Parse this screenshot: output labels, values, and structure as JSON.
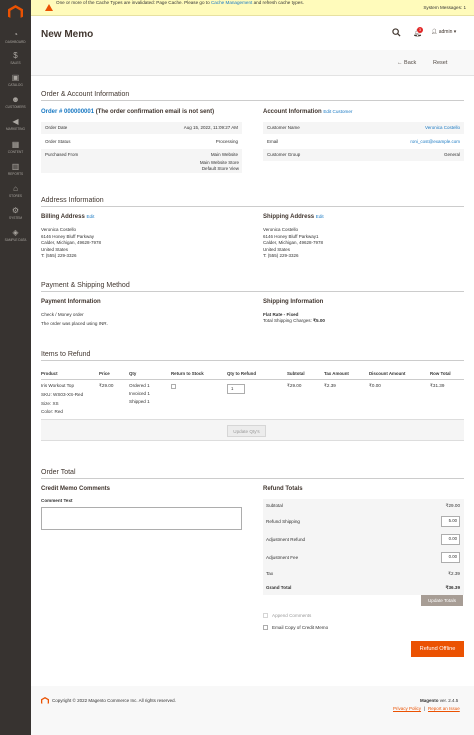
{
  "sidebar": {
    "items": [
      {
        "label": "DASHBOARD",
        "icon": "speedometer-icon",
        "glyph": "◔"
      },
      {
        "label": "SALES",
        "icon": "dollar-icon",
        "glyph": "$"
      },
      {
        "label": "CATALOG",
        "icon": "box-icon",
        "glyph": "▣"
      },
      {
        "label": "CUSTOMERS",
        "icon": "person-icon",
        "glyph": "☻"
      },
      {
        "label": "MARKETING",
        "icon": "megaphone-icon",
        "glyph": "◀"
      },
      {
        "label": "CONTENT",
        "icon": "layout-icon",
        "glyph": "▦"
      },
      {
        "label": "REPORTS",
        "icon": "bar-chart-icon",
        "glyph": "▥"
      },
      {
        "label": "STORES",
        "icon": "storefront-icon",
        "glyph": "⌂"
      },
      {
        "label": "SYSTEM",
        "icon": "gear-icon",
        "glyph": "⚙"
      },
      {
        "label": "SAMPLE DATA",
        "icon": "puzzle-icon",
        "glyph": "◈"
      }
    ]
  },
  "message": {
    "before": "One or more of the Cache Types are invalidated: Page Cache. Please go to",
    "link": "Cache Management",
    "after": "and refresh cache types.",
    "system": "System Messages: 1"
  },
  "header": {
    "title": "New Memo",
    "badge": "3",
    "user": "admin"
  },
  "actions": {
    "back": "← Back",
    "reset": "Reset"
  },
  "order_account": {
    "section": "Order & Account Information",
    "order_link": "Order # 000000001",
    "order_note": "(The order confirmation email is not sent)",
    "rows": [
      {
        "label": "Order Date",
        "value": "Aug 15, 2022, 11:09:27 AM"
      },
      {
        "label": "Order Status",
        "value": "Processing"
      },
      {
        "label": "Purchased From",
        "value": "Main Website"
      }
    ],
    "store1": "Main Website Store",
    "store2": "Default Store View",
    "account_title": "Account Information",
    "edit_customer": "Edit Customer",
    "acc_rows": [
      {
        "label": "Customer Name",
        "value": "Veronica Costello"
      },
      {
        "label": "Email",
        "value": "roni_cost@example.com"
      },
      {
        "label": "Customer Group",
        "value": "General"
      }
    ]
  },
  "address": {
    "section": "Address Information",
    "billing_title": "Billing Address",
    "shipping_title": "Shipping Address",
    "edit": "Edit",
    "billing": [
      "Veronica Costello",
      "6146 Honey Bluff Parkway",
      "Calder, Michigan, 49628-7978",
      "United States",
      "T: (555) 229-3326"
    ],
    "shipping": [
      "Veronica Costello",
      "6146 Honey Bluff Parkway1",
      "Calder, Michigan, 49628-7978",
      "United States",
      "T: (555) 229-3326"
    ]
  },
  "payment": {
    "section": "Payment & Shipping Method",
    "payment_title": "Payment Information",
    "method": "Check / Money order",
    "currency_note": "The order was placed using INR.",
    "shipping_title": "Shipping Information",
    "ship_method": "Flat Rate - Fixed",
    "ship_charges_label": "Total Shipping Charges:",
    "ship_charges": "₹5.00"
  },
  "items": {
    "section": "Items to Refund",
    "headers": [
      "Product",
      "Price",
      "Qty",
      "Return to Stock",
      "Qty to Refund",
      "Subtotal",
      "Tax Amount",
      "Discount Amount",
      "Row Total"
    ],
    "product": {
      "name": "Iris Workout Top",
      "sku": "SKU: WS03-XS-Red",
      "size": "Size: XS",
      "color": "Color: Red",
      "price": "₹29.00",
      "ordered": "Ordered 1",
      "invoiced": "Invoiced 1",
      "shipped": "Shipped 1",
      "qty": "1",
      "subtotal": "₹29.00",
      "tax": "₹2.39",
      "discount": "₹0.00",
      "row_total": "₹31.39"
    },
    "update_btn": "Update Qty's"
  },
  "order_total": {
    "section": "Order Total",
    "comments_title": "Credit Memo Comments",
    "comment_label": "Comment Text",
    "refund_title": "Refund Totals",
    "subtotal_label": "Subtotal",
    "subtotal": "₹29.00",
    "ship_label": "Refund Shipping",
    "ship_val": "5.00",
    "adj_refund_label": "Adjustment Refund",
    "adj_refund": "0.00",
    "adj_fee_label": "Adjustment Fee",
    "adj_fee": "0.00",
    "tax_label": "Tax",
    "tax": "₹2.39",
    "grand_label": "Grand Total",
    "grand": "₹36.39",
    "update_totals": "Update Totals",
    "append": "Append Comments",
    "email_copy": "Email Copy of Credit Memo",
    "refund_btn": "Refund Offline"
  },
  "footer": {
    "copyright": "Copyright © 2022 Magento Commerce Inc. All rights reserved.",
    "brand": "Magento",
    "version": "ver. 2.4.5",
    "privacy": "Privacy Policy",
    "report": "Report an Issue"
  }
}
